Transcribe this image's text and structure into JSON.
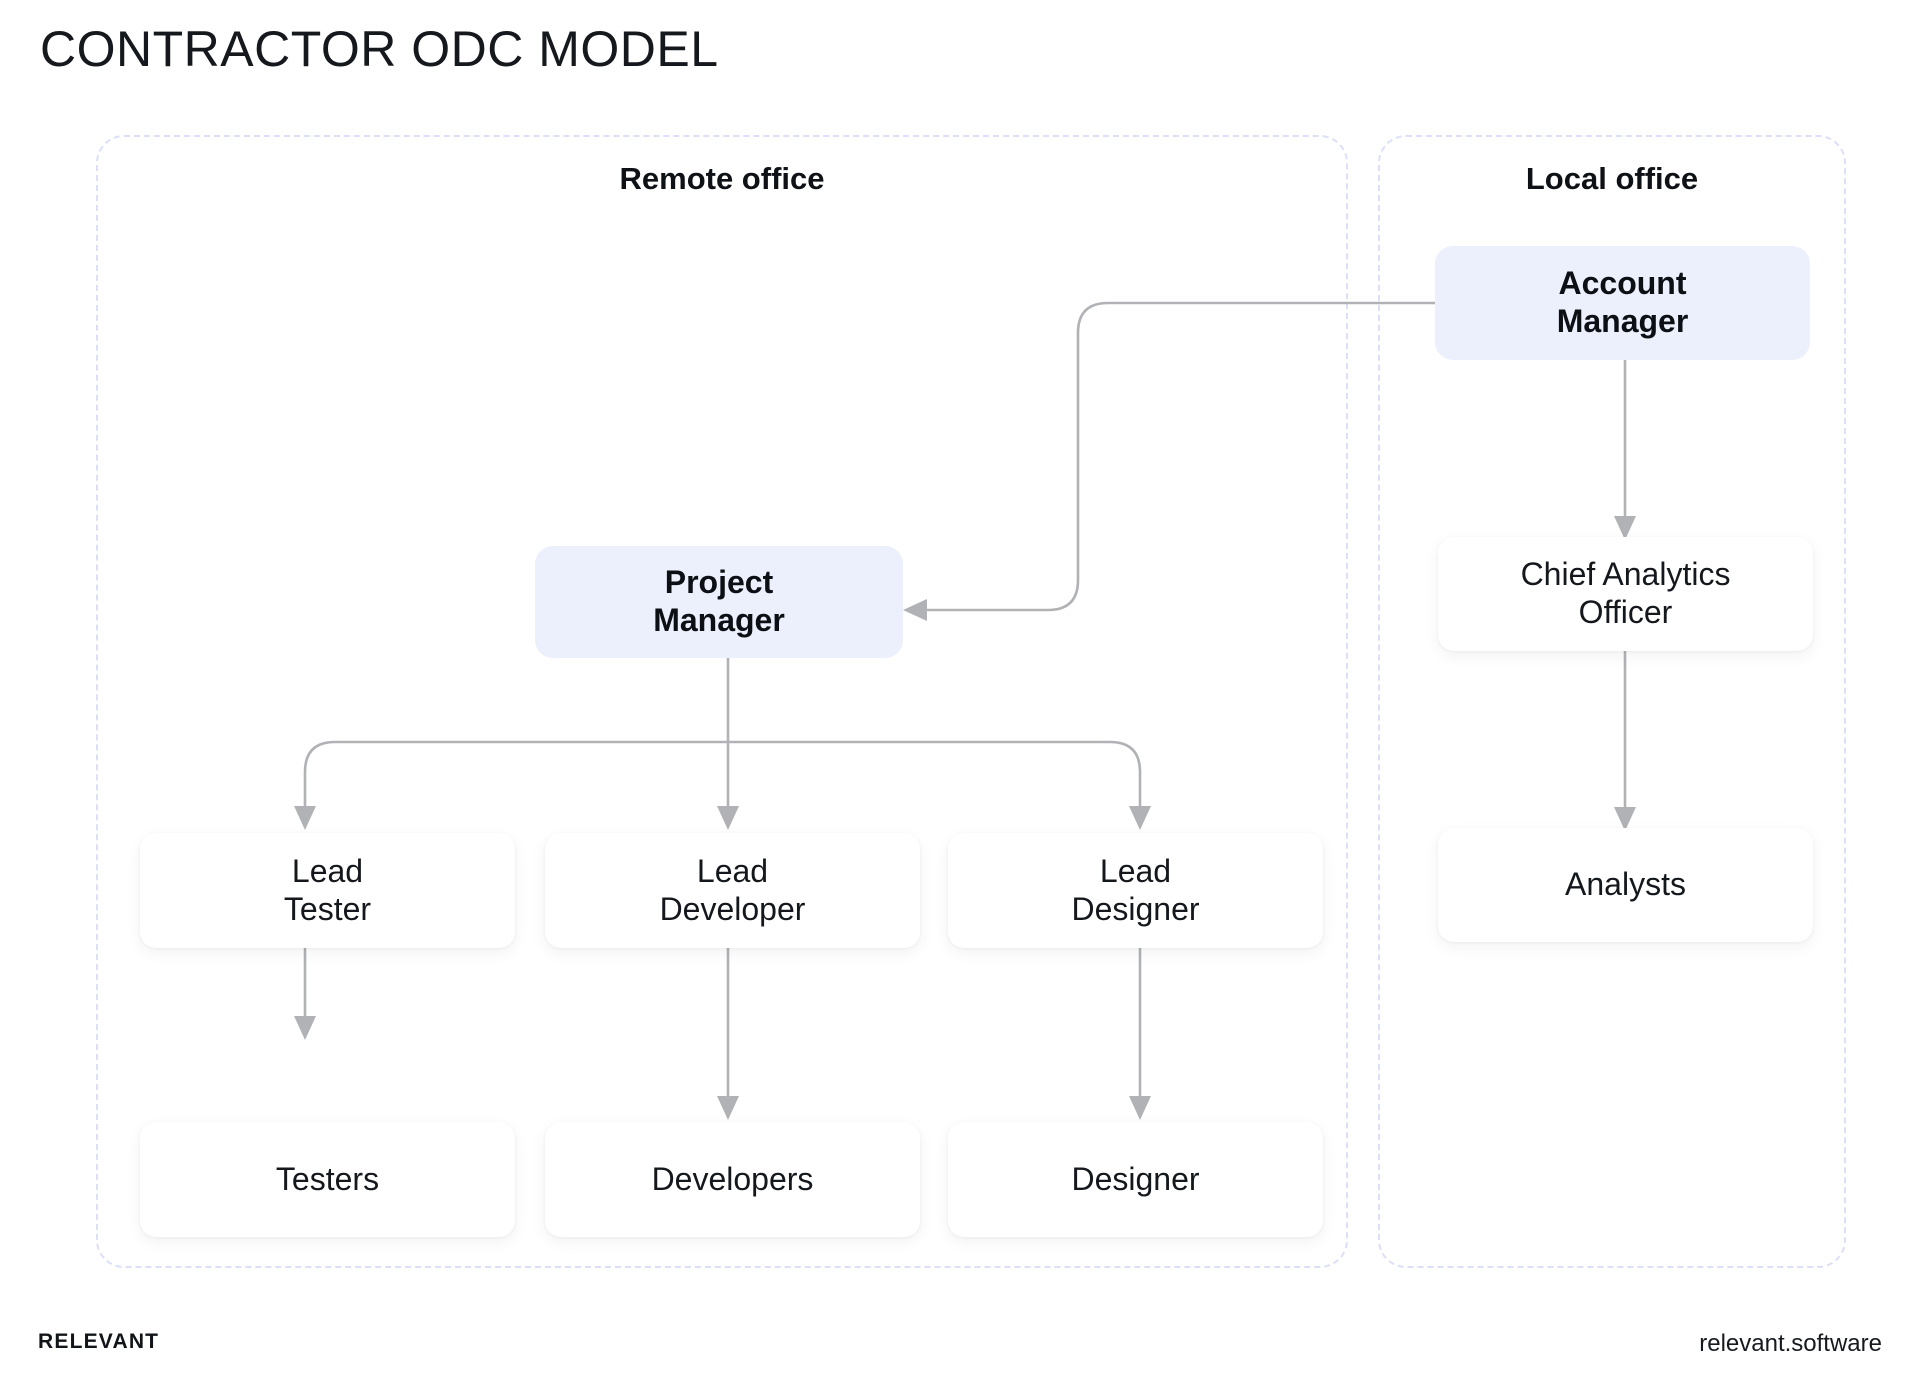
{
  "title": "CONTRACTOR ODC MODEL",
  "panels": {
    "remote": {
      "label": "Remote office"
    },
    "local": {
      "label": "Local office"
    }
  },
  "nodes": {
    "account_manager": "Account\nManager",
    "chief_analytics_officer": "Chief Analytics\nOfficer",
    "analysts": "Analysts",
    "project_manager": "Project\nManager",
    "lead_tester": "Lead\nTester",
    "lead_developer": "Lead\nDeveloper",
    "lead_designer": "Lead\nDesigner",
    "testers": "Testers",
    "developers": "Developers",
    "designer": "Designer"
  },
  "footer": {
    "brand": "RELEVANT",
    "site": "relevant.software"
  },
  "colors": {
    "accent_box_bg": "#ECEFFC",
    "panel_border": "#DBE0F7",
    "connector": "#B1B2B6",
    "text": "#14181D",
    "background": "#FFFFFF"
  }
}
